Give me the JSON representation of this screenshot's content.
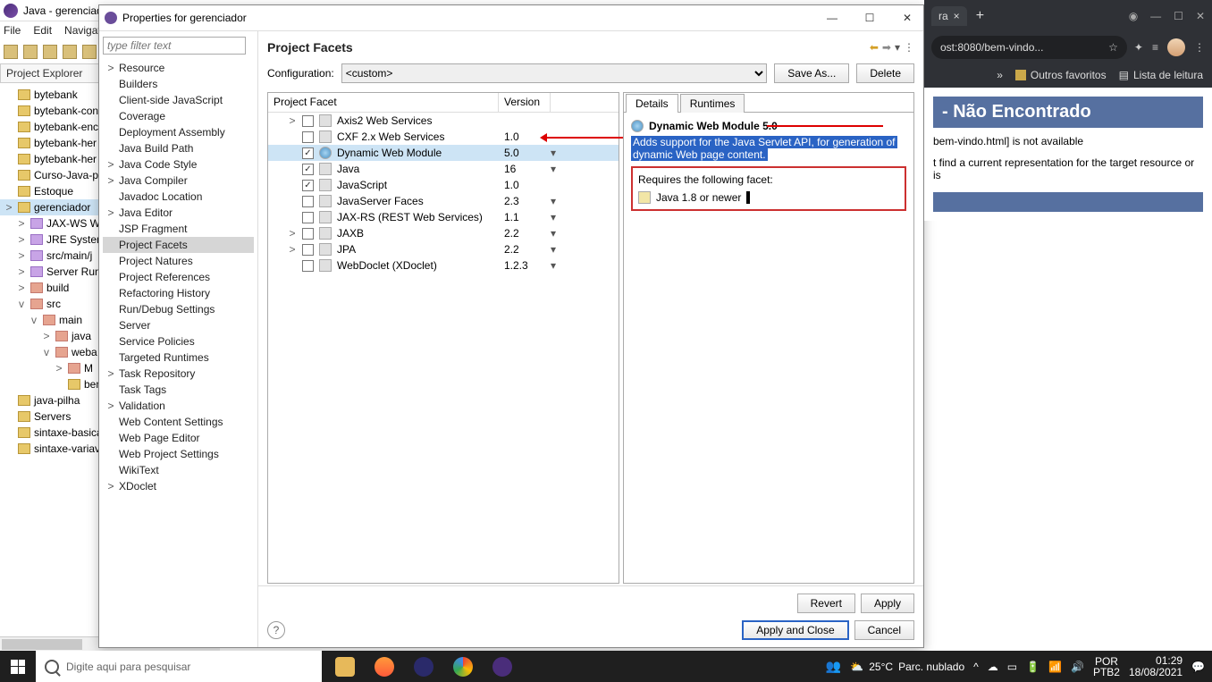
{
  "eclipse": {
    "title": "Java - gerenciad",
    "menu": [
      "File",
      "Edit",
      "Navigat"
    ],
    "project_explorer": "Project Explorer",
    "tree": [
      {
        "label": "bytebank",
        "indent": 0,
        "tw": "",
        "ico": "folder"
      },
      {
        "label": "bytebank-con",
        "indent": 0,
        "tw": "",
        "ico": "folder"
      },
      {
        "label": "bytebank-enc",
        "indent": 0,
        "tw": "",
        "ico": "folder"
      },
      {
        "label": "bytebank-her",
        "indent": 0,
        "tw": "",
        "ico": "folder"
      },
      {
        "label": "bytebank-her",
        "indent": 0,
        "tw": "",
        "ico": "folder"
      },
      {
        "label": "Curso-Java-pa",
        "indent": 0,
        "tw": "",
        "ico": "folder"
      },
      {
        "label": "Estoque",
        "indent": 0,
        "tw": "",
        "ico": "folder"
      },
      {
        "label": "gerenciador",
        "indent": 0,
        "tw": ">",
        "ico": "folder",
        "sel": true,
        "red": true
      },
      {
        "label": "JAX-WS W",
        "indent": 1,
        "tw": ">",
        "ico": "purple"
      },
      {
        "label": "JRE System",
        "indent": 1,
        "tw": ">",
        "ico": "purple"
      },
      {
        "label": "src/main/j",
        "indent": 1,
        "tw": ">",
        "ico": "purple"
      },
      {
        "label": "Server Run",
        "indent": 1,
        "tw": ">",
        "ico": "purple"
      },
      {
        "label": "build",
        "indent": 1,
        "tw": ">",
        "ico": "red"
      },
      {
        "label": "src",
        "indent": 1,
        "tw": "v",
        "ico": "red"
      },
      {
        "label": "main",
        "indent": 2,
        "tw": "v",
        "ico": "red"
      },
      {
        "label": "java",
        "indent": 3,
        "tw": ">",
        "ico": "red"
      },
      {
        "label": "weba",
        "indent": 3,
        "tw": "v",
        "ico": "red"
      },
      {
        "label": "M",
        "indent": 4,
        "tw": ">",
        "ico": "red"
      },
      {
        "label": "bem-vi",
        "indent": 4,
        "tw": "",
        "ico": "file"
      },
      {
        "label": "java-pilha",
        "indent": 0,
        "tw": "",
        "ico": "folder"
      },
      {
        "label": "Servers",
        "indent": 0,
        "tw": "",
        "ico": "folder"
      },
      {
        "label": "sintaxe-basica",
        "indent": 0,
        "tw": "",
        "ico": "folder"
      },
      {
        "label": "sintaxe-variav",
        "indent": 0,
        "tw": "",
        "ico": "folder"
      }
    ]
  },
  "dialog": {
    "title": "Properties for gerenciador",
    "filter_placeholder": "type filter text",
    "nav": [
      {
        "label": "Resource",
        "tw": ">"
      },
      {
        "label": "Builders"
      },
      {
        "label": "Client-side JavaScript"
      },
      {
        "label": "Coverage"
      },
      {
        "label": "Deployment Assembly"
      },
      {
        "label": "Java Build Path"
      },
      {
        "label": "Java Code Style",
        "tw": ">"
      },
      {
        "label": "Java Compiler",
        "tw": ">"
      },
      {
        "label": "Javadoc Location"
      },
      {
        "label": "Java Editor",
        "tw": ">"
      },
      {
        "label": "JSP Fragment"
      },
      {
        "label": "Project Facets",
        "sel": true
      },
      {
        "label": "Project Natures"
      },
      {
        "label": "Project References"
      },
      {
        "label": "Refactoring History"
      },
      {
        "label": "Run/Debug Settings"
      },
      {
        "label": "Server"
      },
      {
        "label": "Service Policies"
      },
      {
        "label": "Targeted Runtimes"
      },
      {
        "label": "Task Repository",
        "tw": ">"
      },
      {
        "label": "Task Tags"
      },
      {
        "label": "Validation",
        "tw": ">"
      },
      {
        "label": "Web Content Settings"
      },
      {
        "label": "Web Page Editor"
      },
      {
        "label": "Web Project Settings"
      },
      {
        "label": "WikiText"
      },
      {
        "label": "XDoclet",
        "tw": ">"
      }
    ],
    "heading": "Project Facets",
    "config_label": "Configuration:",
    "config_value": "<custom>",
    "save_as": "Save As...",
    "delete": "Delete",
    "col1": "Project Facet",
    "col2": "Version",
    "facets": [
      {
        "name": "Axis2 Web Services",
        "ver": "",
        "chk": false,
        "dd": false,
        "tw": ">"
      },
      {
        "name": "CXF 2.x Web Services",
        "ver": "1.0",
        "chk": false,
        "dd": false
      },
      {
        "name": "Dynamic Web Module",
        "ver": "5.0",
        "chk": true,
        "dd": true,
        "sel": true,
        "globe": true
      },
      {
        "name": "Java",
        "ver": "16",
        "chk": true,
        "dd": true
      },
      {
        "name": "JavaScript",
        "ver": "1.0",
        "chk": true,
        "dd": false
      },
      {
        "name": "JavaServer Faces",
        "ver": "2.3",
        "chk": false,
        "dd": true
      },
      {
        "name": "JAX-RS (REST Web Services)",
        "ver": "1.1",
        "chk": false,
        "dd": true
      },
      {
        "name": "JAXB",
        "ver": "2.2",
        "chk": false,
        "dd": true,
        "tw": ">"
      },
      {
        "name": "JPA",
        "ver": "2.2",
        "chk": false,
        "dd": true,
        "tw": ">"
      },
      {
        "name": "WebDoclet (XDoclet)",
        "ver": "1.2.3",
        "chk": false,
        "dd": true
      }
    ],
    "tabs": {
      "details": "Details",
      "runtimes": "Runtimes"
    },
    "det_title": "Dynamic Web Module 5.0",
    "det_desc1": "Adds support for the Java Servlet API, for generation of",
    "det_desc2": "dynamic Web page content.",
    "req_label": "Requires the following facet:",
    "req_item": "Java 1.8 or newer",
    "revert": "Revert",
    "apply": "Apply",
    "apply_close": "Apply and Close",
    "cancel": "Cancel"
  },
  "browser": {
    "tab_label": "ra",
    "url": "ost:8080/bem-vindo...",
    "more": "»",
    "fav": "Outros favoritos",
    "readlist": "Lista de leitura",
    "err_heading": "- Não Encontrado",
    "err_l1": "bem-vindo.html] is not available",
    "err_l2": "t find a current representation for the target resource or is"
  },
  "taskbar": {
    "search_placeholder": "Digite aqui para pesquisar",
    "weather_temp": "25°C",
    "weather_desc": "Parc. nublado",
    "lang1": "POR",
    "lang2": "PTB2",
    "time": "01:29",
    "date": "18/08/2021"
  }
}
